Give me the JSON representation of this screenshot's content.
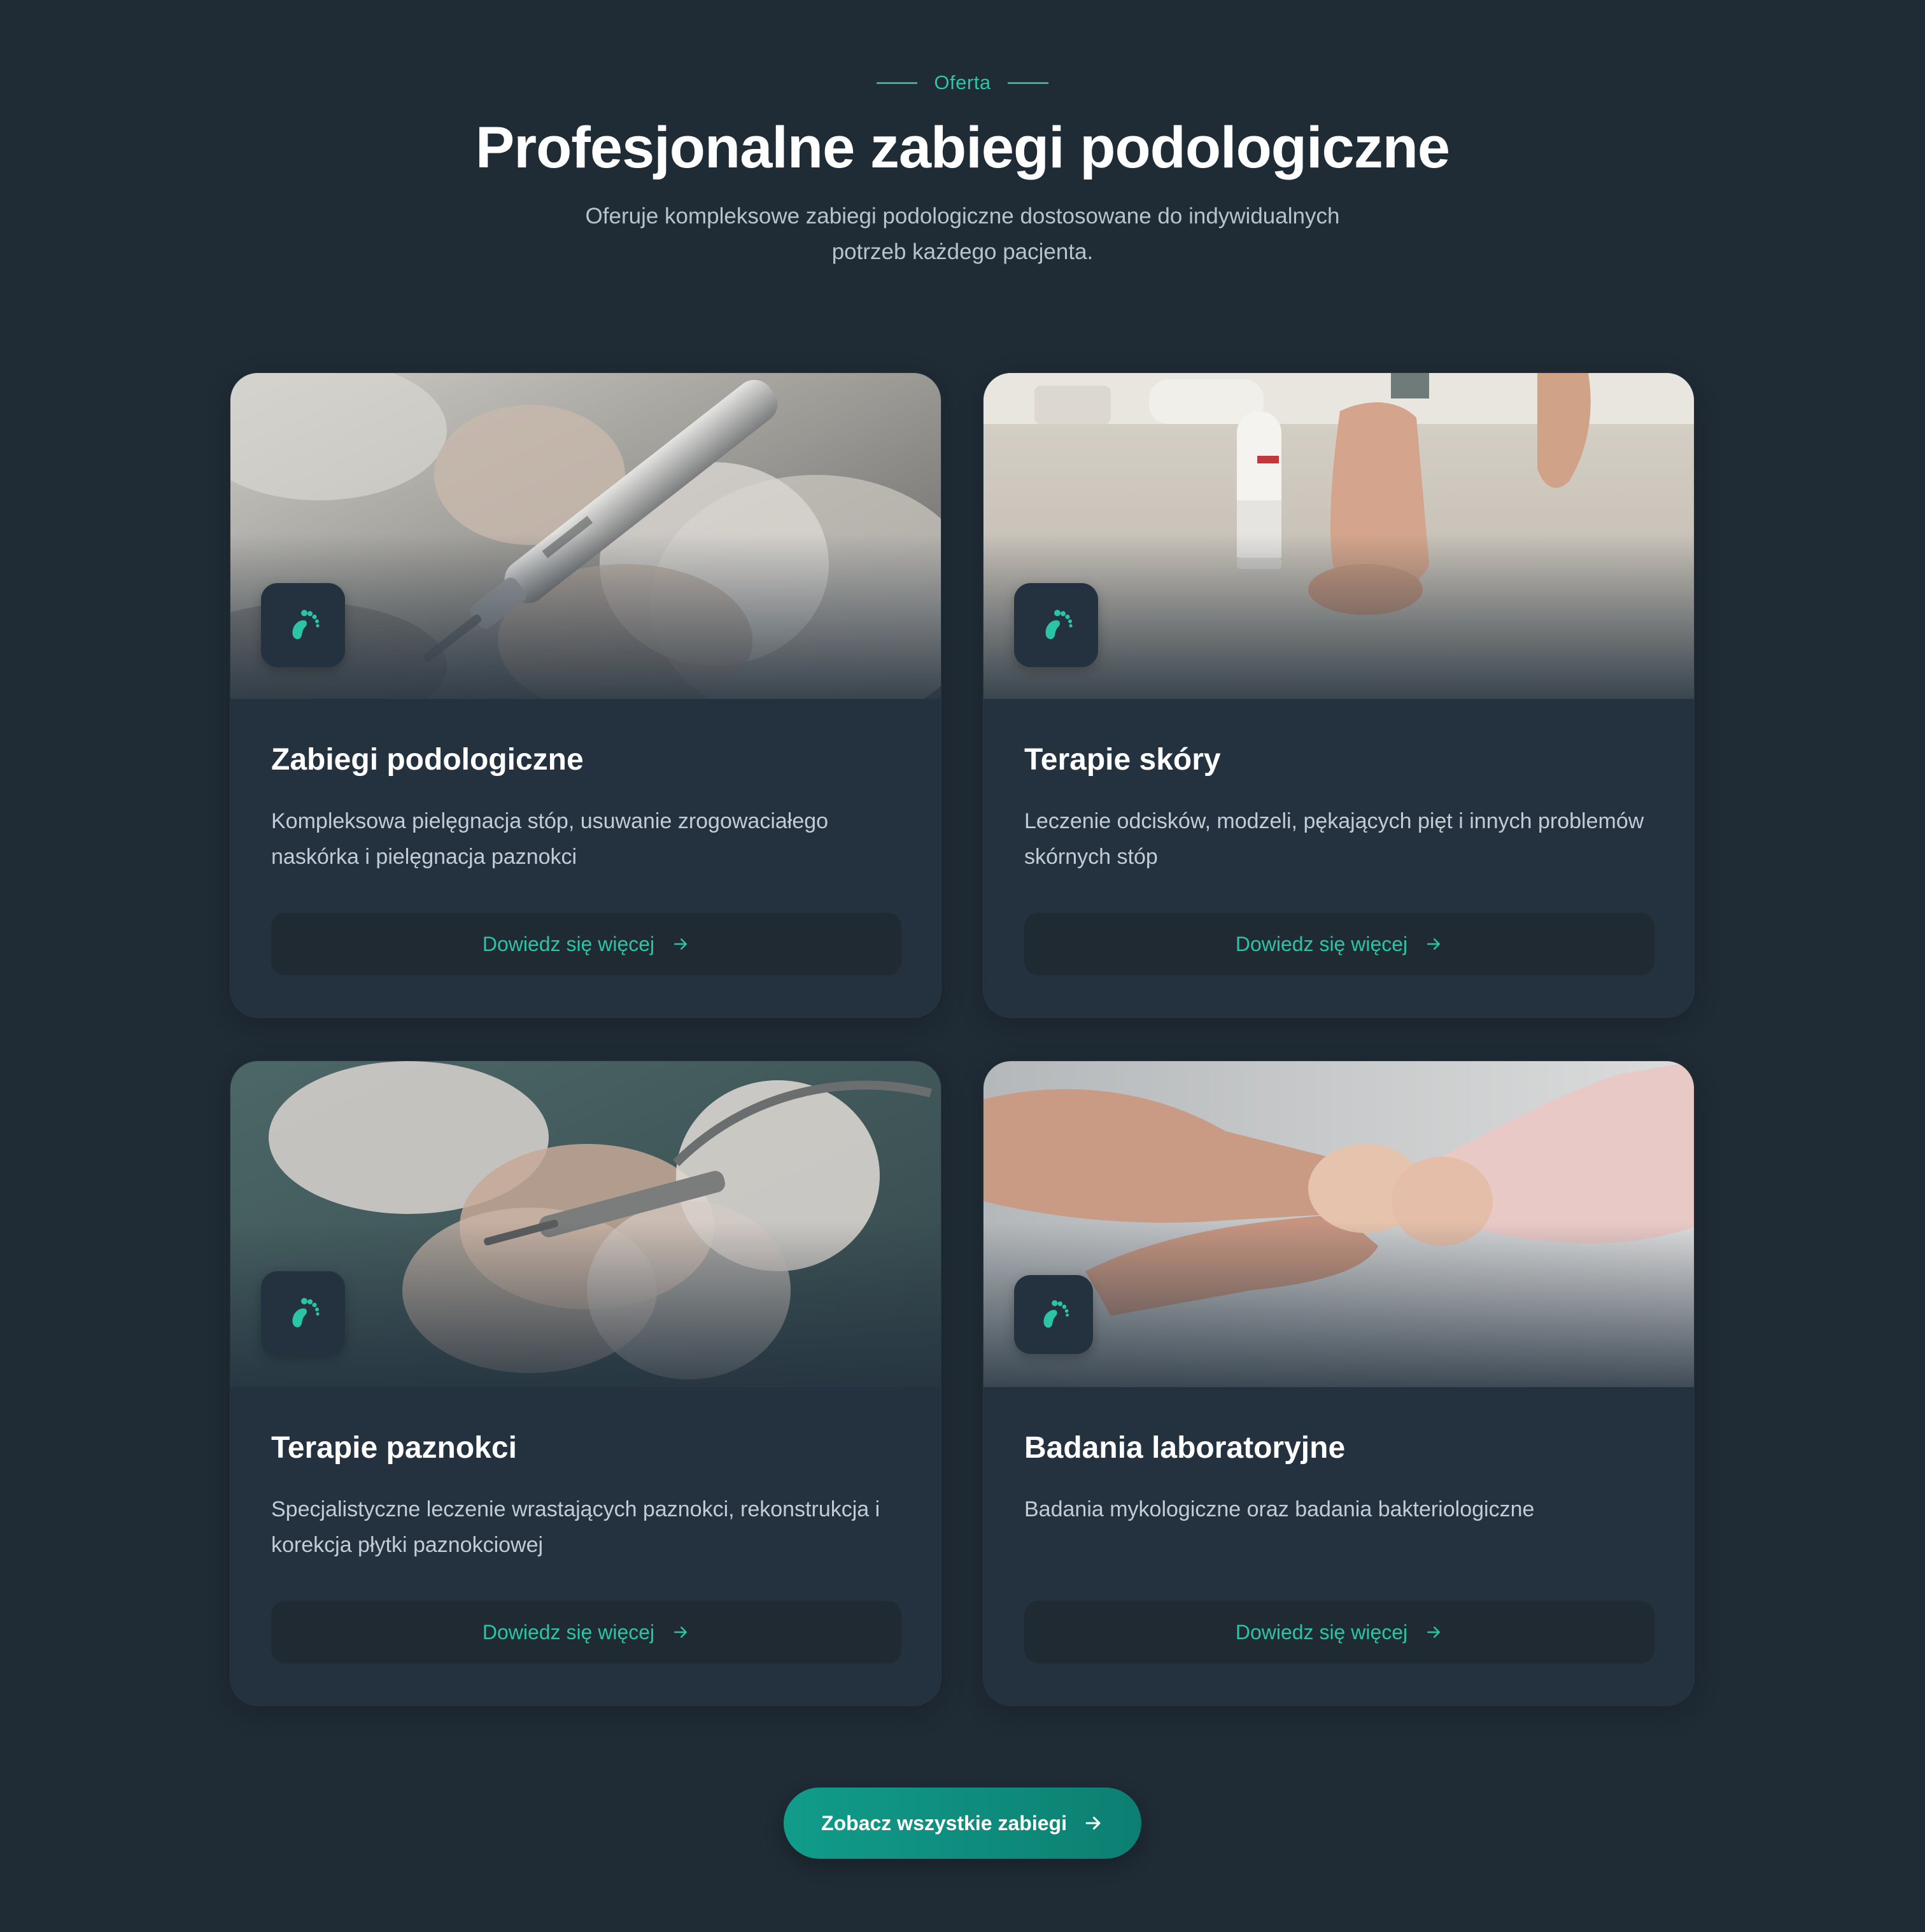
{
  "section": {
    "eyebrow": "Oferta",
    "title": "Profesjonalne zabiegi podologiczne",
    "subtitle": "Oferuje kompleksowe zabiegi podologiczne dostosowane do indywidualnych potrzeb każdego pacjenta."
  },
  "cards": [
    {
      "title": "Zabiegi podologiczne",
      "description": "Kompleksowa pielęgnacja stóp, usuwanie zrogowaciałego naskórka i pielęgnacja paznokci",
      "button": "Dowiedz się więcej",
      "icon": "footprint-icon",
      "photo": "podiatry-drill-photo"
    },
    {
      "title": "Terapie skóry",
      "description": "Leczenie odcisków, modzeli, pękających pięt i innych problemów skórnych stóp",
      "button": "Dowiedz się więcej",
      "icon": "footprint-icon",
      "photo": "foot-cream-photo"
    },
    {
      "title": "Terapie paznokci",
      "description": "Specjalistyczne leczenie wrastających paznokci, rekonstrukcja i korekcja płytki paznokciowej",
      "button": "Dowiedz się więcej",
      "icon": "footprint-icon",
      "photo": "nail-clipper-photo"
    },
    {
      "title": "Badania laboratoryjne",
      "description": "Badania mykologiczne oraz badania bakteriologiczne",
      "button": "Dowiedz się więcej",
      "icon": "footprint-icon",
      "photo": "hands-baby-foot-photo"
    }
  ],
  "cta": {
    "label": "Zobacz wszystkie zabiegi"
  },
  "colors": {
    "background": "#1f2b35",
    "card": "#24323f",
    "accent": "#2cc4a6",
    "cta": "#119c8a"
  }
}
